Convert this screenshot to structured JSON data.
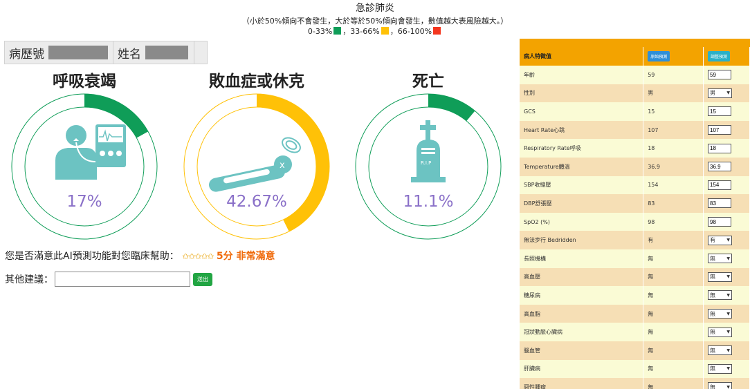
{
  "header": {
    "title": "急診肺炎",
    "subtitle": "（小於50%傾向不會發生，大於等於50%傾向會發生，數值越大表風險越大。）",
    "legend": [
      {
        "text": "0-33%",
        "color": "#0f9d58"
      },
      {
        "text": "，33-66%",
        "color": "#ffc107"
      },
      {
        "text": "，66-100%",
        "color": "#f4361e"
      }
    ]
  },
  "patient": {
    "chart_no_label": "病歷號",
    "name_label": "姓名"
  },
  "gauges": [
    {
      "title": "呼吸衰竭",
      "percent_text": "17%",
      "fraction": 0.17,
      "color": "#0f9d58",
      "icon": "ventilator-patient-icon"
    },
    {
      "title": "敗血症或休克",
      "percent_text": "42.67%",
      "fraction": 0.4267,
      "color": "#ffc107",
      "icon": "lying-patient-icon"
    },
    {
      "title": "死亡",
      "percent_text": "11.1%",
      "fraction": 0.111,
      "color": "#0f9d58",
      "icon": "tombstone-icon"
    }
  ],
  "tombstone_text": "R.I.P",
  "feedback": {
    "question": "您是否滿意此AI預測功能對您臨床幫助：",
    "stars": "✩✩✩✩✩",
    "score": "5分 非常滿意",
    "suggest_label": "其他建議：",
    "suggest_value": "",
    "send_label": "送出"
  },
  "table": {
    "header": {
      "col1": "病人特徵值",
      "btn_original": "原始預測",
      "btn_adjust": "調整預測"
    },
    "rows": [
      {
        "label": "年齡",
        "value": "59",
        "input": "59",
        "kind": "input"
      },
      {
        "label": "性別",
        "value": "男",
        "input": "男",
        "kind": "select"
      },
      {
        "label": "GCS",
        "value": "15",
        "input": "15",
        "kind": "input"
      },
      {
        "label": "Heart Rate心跳",
        "value": "107",
        "input": "107",
        "kind": "input"
      },
      {
        "label": "Respiratory Rate呼吸",
        "value": "18",
        "input": "18",
        "kind": "input"
      },
      {
        "label": "Temperature體溫",
        "value": "36.9",
        "input": "36.9",
        "kind": "input"
      },
      {
        "label": "SBP收縮壓",
        "value": "154",
        "input": "154",
        "kind": "input"
      },
      {
        "label": "DBP舒張壓",
        "value": "83",
        "input": "83",
        "kind": "input"
      },
      {
        "label": "SpO2 (%)",
        "value": "98",
        "input": "98",
        "kind": "input"
      },
      {
        "label": "無法步行 Bedridden",
        "value": "有",
        "input": "有",
        "kind": "select"
      },
      {
        "label": "長照機構",
        "value": "無",
        "input": "無",
        "kind": "select"
      },
      {
        "label": "高血壓",
        "value": "無",
        "input": "無",
        "kind": "select"
      },
      {
        "label": "糖尿病",
        "value": "無",
        "input": "無",
        "kind": "select"
      },
      {
        "label": "高血脂",
        "value": "無",
        "input": "無",
        "kind": "select"
      },
      {
        "label": "冠狀動脈心臟病",
        "value": "無",
        "input": "無",
        "kind": "select"
      },
      {
        "label": "腦血管",
        "value": "無",
        "input": "無",
        "kind": "select"
      },
      {
        "label": "肝臟病",
        "value": "無",
        "input": "無",
        "kind": "select"
      },
      {
        "label": "惡性腫瘤",
        "value": "無",
        "input": "無",
        "kind": "select"
      }
    ]
  }
}
